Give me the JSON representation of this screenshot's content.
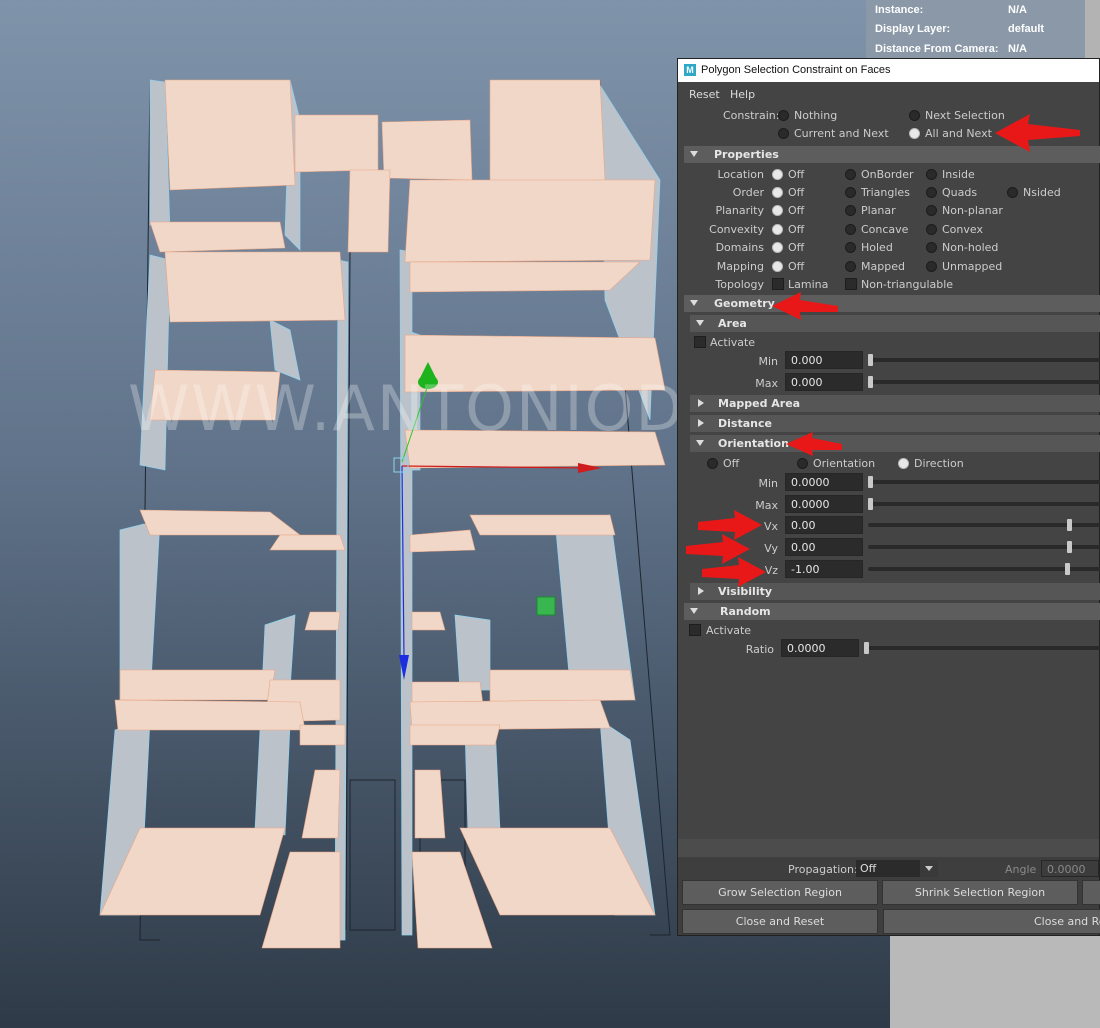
{
  "watermark": "WWW.ANTONIODOSI.COM",
  "hud": {
    "instance_label": "Instance:",
    "instance_value": "N/A",
    "display_layer_label": "Display Layer:",
    "display_layer_value": "default",
    "distance_label": "Distance From Camera:",
    "distance_value": "N/A"
  },
  "dialog": {
    "title": "Polygon Selection Constraint on Faces",
    "app_icon": "M",
    "menu": [
      "Reset",
      "Help"
    ],
    "constrain_label": "Constrain:",
    "constrain_options": [
      "Nothing",
      "Next Selection",
      "Current and Next",
      "All and Next"
    ],
    "constrain_selected": "All and Next",
    "properties_title": "Properties",
    "properties_rows": [
      {
        "label": "Location",
        "options": [
          "Off",
          "OnBorder",
          "Inside"
        ]
      },
      {
        "label": "Order",
        "options": [
          "Off",
          "Triangles",
          "Quads",
          "Nsided"
        ]
      },
      {
        "label": "Planarity",
        "options": [
          "Off",
          "Planar",
          "Non-planar"
        ]
      },
      {
        "label": "Convexity",
        "options": [
          "Off",
          "Concave",
          "Convex"
        ]
      },
      {
        "label": "Domains",
        "options": [
          "Off",
          "Holed",
          "Non-holed"
        ]
      },
      {
        "label": "Mapping",
        "options": [
          "Off",
          "Mapped",
          "Unmapped"
        ]
      }
    ],
    "topology_label": "Topology",
    "topology_options": [
      "Lamina",
      "Non-triangulable"
    ],
    "geometry_title": "Geometry",
    "area_title": "Area",
    "area_activate": "Activate",
    "area_min_label": "Min",
    "area_min": "0.000",
    "area_max_label": "Max",
    "area_max": "0.000",
    "mapped_area_title": "Mapped Area",
    "distance_title": "Distance",
    "orientation_title": "Orientation",
    "orientation_options": [
      "Off",
      "Orientation",
      "Direction"
    ],
    "orientation_selected": "Direction",
    "orient_min_label": "Min",
    "orient_min": "0.0000",
    "orient_max_label": "Max",
    "orient_max": "0.0000",
    "vx_label": "Vx",
    "vx": "0.00",
    "vy_label": "Vy",
    "vy": "0.00",
    "vz_label": "Vz",
    "vz": "-1.00",
    "visibility_title": "Visibility",
    "random_title": "Random",
    "random_activate": "Activate",
    "ratio_label": "Ratio",
    "ratio": "0.0000",
    "propagation_label": "Propagation:",
    "propagation_value": "Off",
    "angle_label": "Angle",
    "angle_value": "0.0000",
    "grow_button": "Grow Selection Region",
    "shrink_button": "Shrink Selection Region",
    "close_reset_button": "Close and Reset",
    "close_remember_button": "Close and Remember"
  },
  "colors": {
    "annotation_arrow": "#e81818",
    "wall_face": "#f0d6c6",
    "wall_side": "#b9bec6",
    "gizmo_y": "#1db31d",
    "gizmo_z": "#1c2fe0",
    "gizmo_x": "#d01c1c"
  }
}
